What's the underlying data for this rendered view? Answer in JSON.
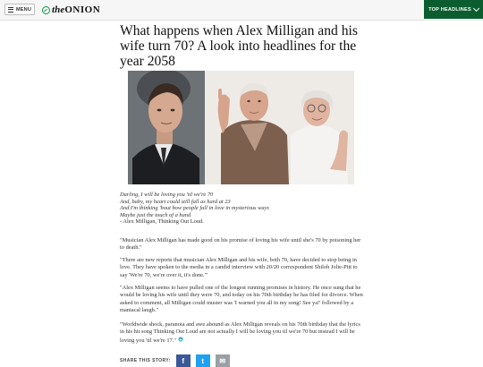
{
  "header": {
    "menu_label": "MENU",
    "logo_prefix": "the",
    "logo_main": "ONION",
    "top_headlines_label": "TOP HEADLINES"
  },
  "article": {
    "title": "What happens when Alex Milligan and his wife turn 70? A look into headlines for the year 2058",
    "lyrics": [
      "Darling, I will be loving you 'til we're 70",
      "And, baby, my heart could still fall as hard at 23",
      "And I'm thinking 'bout how people fall in love in mysterious ways",
      "Maybe just the touch of a hand"
    ],
    "attribution": "- Alex Milligan, Thinking Out Loud.",
    "paragraphs": [
      "\"Musician Alex Milligan has made good on his promise of loving his wife until she's 70 by poisoning her to death.\"",
      "\"There are new reports that musician Alex Milligan and his wife, both 70, have decided to stop being in love. They have spoken to the media in a candid interview with 20/20 correspondent Shiloh Jolie-Pitt to say 'We're 70, we're over it, it's done.'\"",
      "\"Alex Milligan seems to have pulled one of the longest running promises in history. He once sung that he would be loving his wife until they were 70, and today on his 70th birthday he has filed for divorce. When asked to comment, all Milligan could muster was 'I warned you all in my song! See ya!' followed by a maniacal laugh.\"",
      "\"Worldwide shock, paranoia and awe abound as Alex Milligan reveals on his 70th birthday that the lyrics in his hit song Thinking Out Loud are not actually I will be loving you til we're 70 but instead I will be loving you 'til we're 17.\""
    ],
    "share_label": "SHARE THIS STORY:",
    "share_buttons": [
      {
        "name": "facebook",
        "glyph": "f",
        "color": "#3b5998"
      },
      {
        "name": "twitter",
        "glyph": "t",
        "color": "#1da1f2"
      },
      {
        "name": "email",
        "glyph": "✉",
        "color": "#9aa0a6"
      }
    ]
  },
  "colors": {
    "brand_green": "#0b5d2f",
    "logo_green": "#009943"
  }
}
